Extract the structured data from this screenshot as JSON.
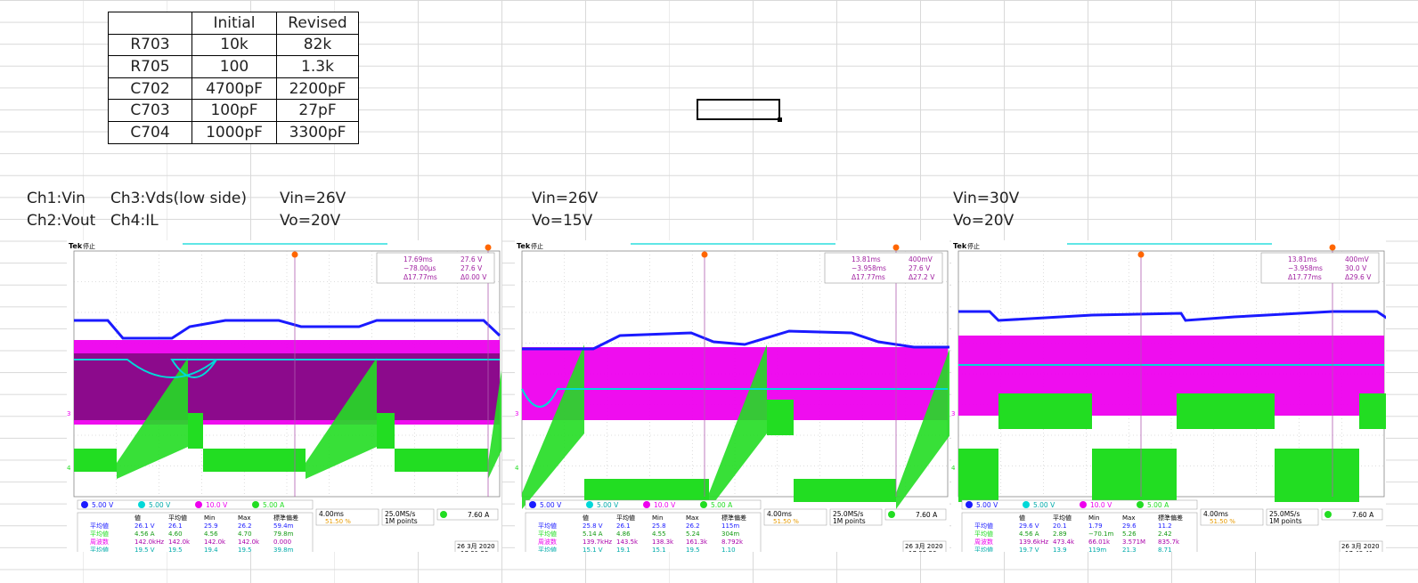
{
  "table": {
    "header": [
      "",
      "Initial",
      "Revised"
    ],
    "rows": [
      [
        "R703",
        "10k",
        "82k"
      ],
      [
        "R705",
        "100",
        "1.3k"
      ],
      [
        "C702",
        "4700pF",
        "2200pF"
      ],
      [
        "C703",
        "100pF",
        "27pF"
      ],
      [
        "C704",
        "1000pF",
        "3300pF"
      ]
    ]
  },
  "labels": {
    "ch1": "Ch1:Vin",
    "ch2": "Ch2:Vout",
    "ch3": "Ch3:Vds(low side)",
    "ch4": "Ch4:IL",
    "s1_vin": "Vin=26V",
    "s1_vo": "Vo=20V",
    "s2_vin": "Vin=26V",
    "s2_vo": "Vo=15V",
    "s3_vin": "Vin=30V",
    "s3_vo": "Vo=20V"
  },
  "colors": {
    "ch1": "#1a1aff",
    "ch2": "#00d8d8",
    "ch3": "#ee00ee",
    "ch4": "#22dd22",
    "cursor": "#ff6600"
  },
  "scopes": [
    {
      "brand": "Tek",
      "status": "停止",
      "cursor_a": "17.69ms",
      "cursor_a_v": "27.6 V",
      "cursor_b": "−78.00μs",
      "cursor_b_v": "27.6 V",
      "delta_t": "Δ17.77ms",
      "delta_v": "Δ0.00 V",
      "ch_scales": [
        "5.00 V",
        "5.00 V",
        "10.0 V",
        "5.00 A"
      ],
      "stats_header": [
        "値",
        "平均値",
        "Min",
        "Max",
        "標準偏差"
      ],
      "stats": [
        [
          "平均値",
          "26.1 V",
          "26.1",
          "25.9",
          "26.2",
          "59.4m"
        ],
        [
          "平均値",
          "4.56 A",
          "4.60",
          "4.56",
          "4.70",
          "79.8m"
        ],
        [
          "周波数",
          "142.0kHz",
          "142.0k",
          "142.0k",
          "142.0k",
          "0.000"
        ],
        [
          "平均値",
          "19.5 V",
          "19.5",
          "19.4",
          "19.5",
          "39.8m"
        ],
        [
          "+デューティ",
          "74.41 %",
          "74.41",
          "74.41",
          "74.41",
          "0.000"
        ]
      ],
      "timebase": "4.00ms",
      "trig_pos": "51.50 %",
      "sample": "25.0MS/s",
      "points": "1M points",
      "trig_level": "7.60 A",
      "date": "26 3月 2020",
      "time": "17:31:29"
    },
    {
      "brand": "Tek",
      "status": "停止",
      "cursor_a": "13.81ms",
      "cursor_a_v": "400mV",
      "cursor_b": "−3.958ms",
      "cursor_b_v": "27.6 V",
      "delta_t": "Δ17.77ms",
      "delta_v": "Δ27.2 V",
      "ch_scales": [
        "5.00 V",
        "5.00 V",
        "10.0 V",
        "5.00 A"
      ],
      "stats_header": [
        "値",
        "平均値",
        "Min",
        "Max",
        "標準偏差"
      ],
      "stats": [
        [
          "平均値",
          "25.8 V",
          "26.1",
          "25.8",
          "26.2",
          "115m"
        ],
        [
          "平均値",
          "5.14 A",
          "4.86",
          "4.55",
          "5.24",
          "304m"
        ],
        [
          "周波数",
          "139.7kHz",
          "143.5k",
          "138.3k",
          "161.3k",
          "8.792k"
        ],
        [
          "平均値",
          "15.1 V",
          "19.1",
          "15.1",
          "19.5",
          "1.10"
        ],
        [
          "+デューティ",
          "63.73 %",
          "75.02",
          "59.18",
          "97.84",
          "13.66"
        ]
      ],
      "timebase": "4.00ms",
      "trig_pos": "51.50 %",
      "sample": "25.0MS/s",
      "points": "1M points",
      "trig_level": "7.60 A",
      "date": "26 3月 2020",
      "time": "17:32:26"
    },
    {
      "brand": "Tek",
      "status": "停止",
      "cursor_a": "13.81ms",
      "cursor_a_v": "400mV",
      "cursor_b": "−3.958ms",
      "cursor_b_v": "30.0 V",
      "delta_t": "Δ17.77ms",
      "delta_v": "Δ29.6 V",
      "ch_scales": [
        "5.00 V",
        "5.00 V",
        "10.0 V",
        "5.00 A"
      ],
      "stats_header": [
        "値",
        "平均値",
        "Min",
        "Max",
        "標準偏差"
      ],
      "stats": [
        [
          "平均値",
          "29.6 V",
          "20.1",
          "1.79",
          "29.6",
          "11.2"
        ],
        [
          "平均値",
          "4.56 A",
          "2.89",
          "−70.1m",
          "5.26",
          "2.42"
        ],
        [
          "周波数",
          "139.6kHz",
          "473.4k",
          "66.01k",
          "3.571M",
          "835.7k"
        ],
        [
          "平均値",
          "19.7 V",
          "13.9",
          "119m",
          "21.3",
          "8.71"
        ],
        [
          "+デューティ",
          "65.46 %",
          "56.26",
          "1.603",
          "97.84",
          "29.20"
        ]
      ],
      "timebase": "4.00ms",
      "trig_pos": "51.50 %",
      "sample": "25.0MS/s",
      "points": "1M points",
      "trig_level": "7.60 A",
      "date": "26 3月 2020",
      "time": "17:43:41"
    }
  ]
}
